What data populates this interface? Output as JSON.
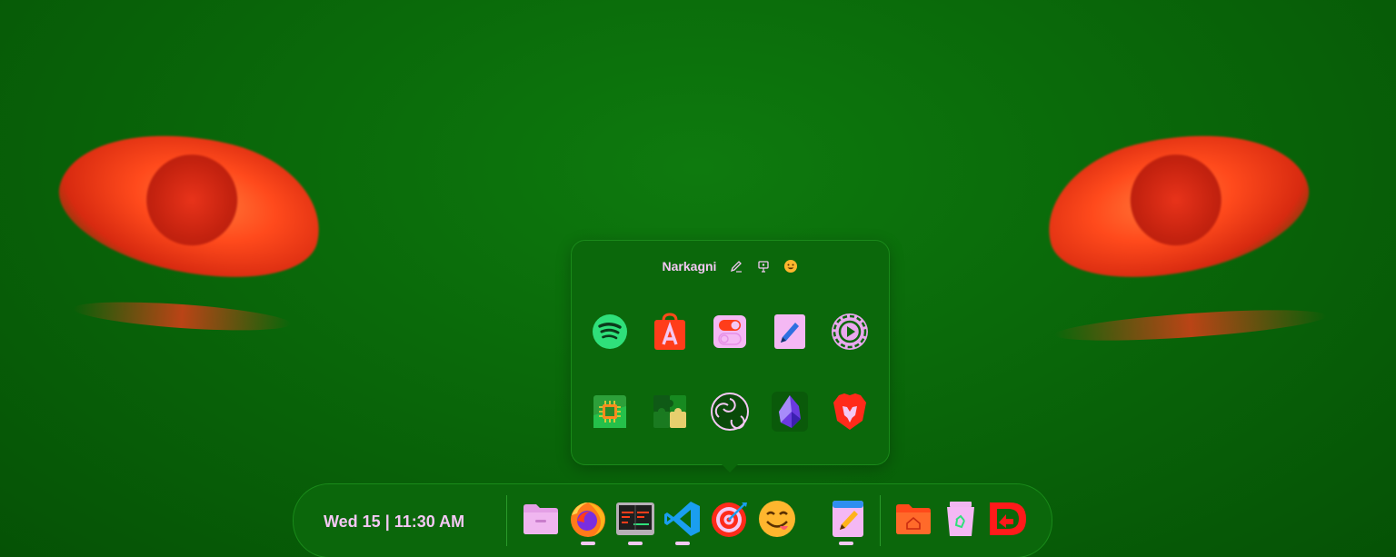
{
  "popup": {
    "user_name": "Narkagni",
    "header_icons": [
      "edit-icon",
      "presentation-icon",
      "emoji-icon"
    ],
    "apps": [
      {
        "name": "spotify-icon"
      },
      {
        "name": "app-store-icon"
      },
      {
        "name": "toggle-settings-icon"
      },
      {
        "name": "text-editor-icon"
      },
      {
        "name": "media-settings-icon"
      },
      {
        "name": "cpu-monitor-icon"
      },
      {
        "name": "puzzle-extensions-icon"
      },
      {
        "name": "obs-icon"
      },
      {
        "name": "obsidian-icon"
      },
      {
        "name": "brave-browser-icon"
      }
    ]
  },
  "dock": {
    "clock": "Wed 15 | 11:30 AM",
    "apps": [
      {
        "name": "files-icon",
        "running": false
      },
      {
        "name": "firefox-icon",
        "running": true
      },
      {
        "name": "system-monitor-icon",
        "running": true
      },
      {
        "name": "vscode-icon",
        "running": true
      },
      {
        "name": "focus-target-icon",
        "running": false
      },
      {
        "name": "emoji-picker-icon",
        "running": false
      },
      {
        "name": "notes-icon",
        "running": true
      },
      {
        "name": "home-folder-icon",
        "running": false
      },
      {
        "name": "trash-icon",
        "running": false
      },
      {
        "name": "redirect-app-icon",
        "running": false
      }
    ]
  },
  "colors": {
    "accent_pink": "#f4c8f4",
    "panel_green": "#0b670b",
    "wallpaper_red": "#ff4a1c"
  }
}
